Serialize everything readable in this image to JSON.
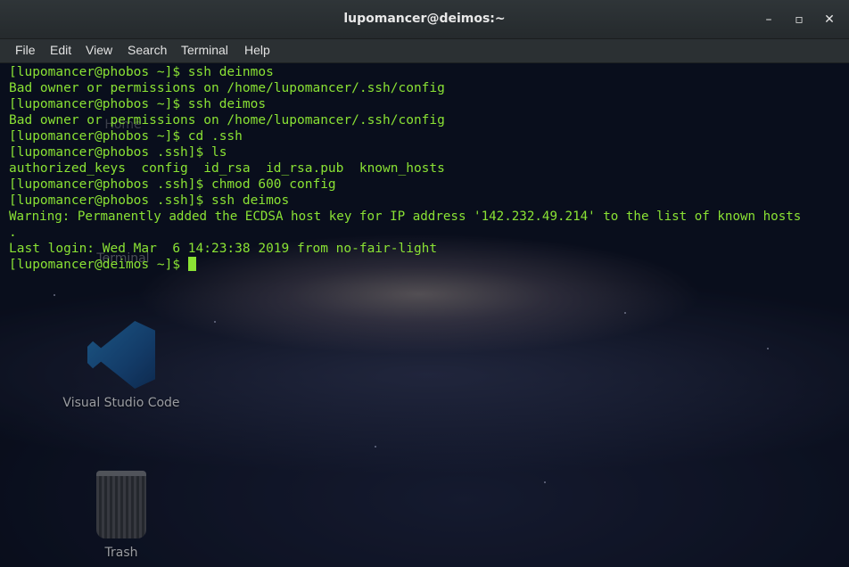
{
  "window": {
    "title": "lupomancer@deimos:~",
    "minimize_glyph": "–",
    "maximize_glyph": "▫",
    "close_glyph": "✕"
  },
  "menu": [
    "File",
    "Edit",
    "View",
    "Search",
    "Terminal",
    "Help"
  ],
  "terminal": {
    "lines": [
      "[lupomancer@phobos ~]$ ssh deinmos",
      "Bad owner or permissions on /home/lupomancer/.ssh/config",
      "[lupomancer@phobos ~]$ ssh deimos",
      "Bad owner or permissions on /home/lupomancer/.ssh/config",
      "[lupomancer@phobos ~]$ cd .ssh",
      "[lupomancer@phobos .ssh]$ ls",
      "authorized_keys  config  id_rsa  id_rsa.pub  known_hosts",
      "[lupomancer@phobos .ssh]$ chmod 600 config",
      "[lupomancer@phobos .ssh]$ ssh deimos",
      "Warning: Permanently added the ECDSA host key for IP address '142.232.49.214' to the list of known hosts",
      ".",
      "Last login: Wed Mar  6 14:23:38 2019 from no-fair-light"
    ],
    "prompt": "[lupomancer@deimos ~]$ ",
    "text_color": "#8ae234"
  },
  "desktop": {
    "icons": [
      {
        "label": "Home",
        "icon": "home-folder-icon"
      },
      {
        "label": "Terminal",
        "icon": "terminal-app-icon"
      },
      {
        "label": "Visual Studio Code",
        "icon": "vscode-icon"
      },
      {
        "label": "Trash",
        "icon": "trash-icon"
      }
    ]
  }
}
